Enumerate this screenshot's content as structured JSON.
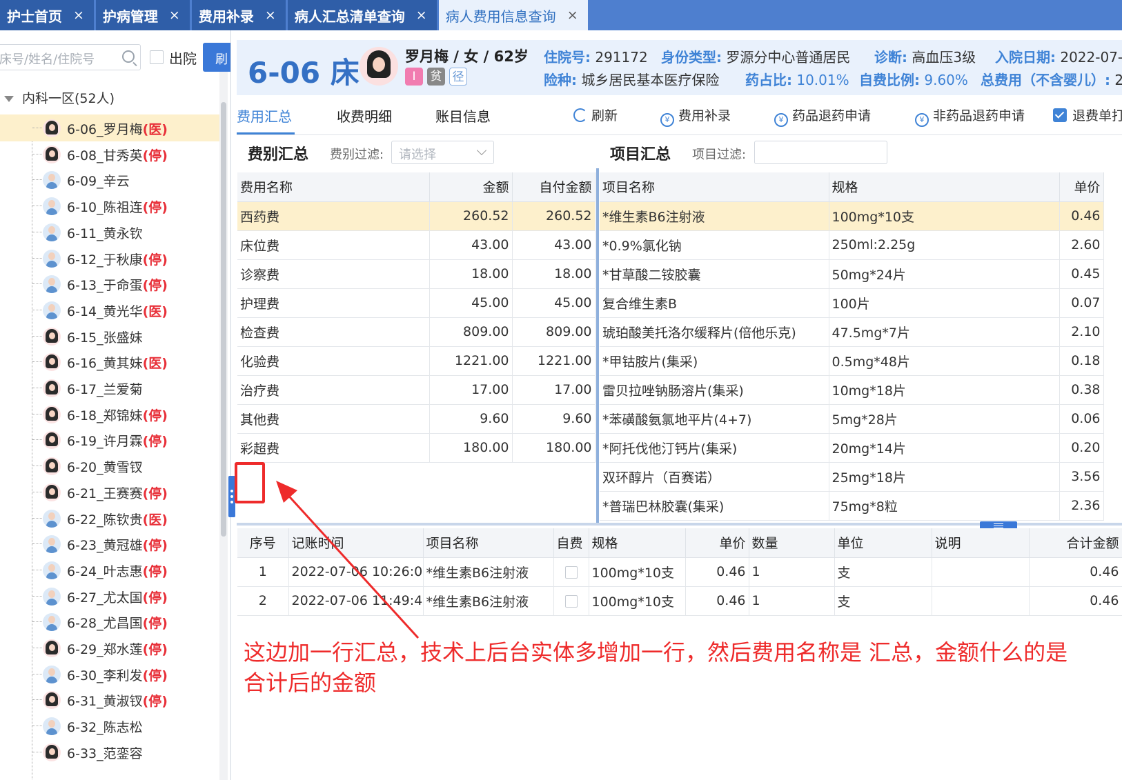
{
  "tabs": [
    {
      "label": "护士首页",
      "active": false
    },
    {
      "label": "护病管理",
      "active": false
    },
    {
      "label": "费用补录",
      "active": false
    },
    {
      "label": "病人汇总清单查询",
      "active": false
    },
    {
      "label": "病人费用信息查询",
      "active": true
    }
  ],
  "tab_close_glyph": "×",
  "sidebar": {
    "search_placeholder": "床号/姓名/住院号",
    "discharged_label": "出院",
    "refresh_label": "刷",
    "ward": "内科一区(52人)",
    "patients": [
      {
        "label": "6-06_罗月梅",
        "status": "(医)",
        "gender": "f",
        "selected": true
      },
      {
        "label": "6-08_甘秀英",
        "status": "(停)",
        "gender": "f"
      },
      {
        "label": "6-09_辛云",
        "status": "",
        "gender": "m"
      },
      {
        "label": "6-10_陈祖连",
        "status": "(停)",
        "gender": "m"
      },
      {
        "label": "6-11_黄永钦",
        "status": "",
        "gender": "m"
      },
      {
        "label": "6-12_于秋康",
        "status": "(停)",
        "gender": "m"
      },
      {
        "label": "6-13_于命蛋",
        "status": "(停)",
        "gender": "m"
      },
      {
        "label": "6-14_黄光华",
        "status": "(医)",
        "gender": "m"
      },
      {
        "label": "6-15_张盛妹",
        "status": "",
        "gender": "f"
      },
      {
        "label": "6-16_黄其妹",
        "status": "(医)",
        "gender": "f"
      },
      {
        "label": "6-17_兰爱菊",
        "status": "",
        "gender": "f"
      },
      {
        "label": "6-18_郑锦妹",
        "status": "(停)",
        "gender": "f"
      },
      {
        "label": "6-19_许月霖",
        "status": "(停)",
        "gender": "f"
      },
      {
        "label": "6-20_黄雪钗",
        "status": "",
        "gender": "f"
      },
      {
        "label": "6-21_王赛赛",
        "status": "(停)",
        "gender": "f"
      },
      {
        "label": "6-22_陈钦贵",
        "status": "(医)",
        "gender": "m"
      },
      {
        "label": "6-23_黄冠雄",
        "status": "(停)",
        "gender": "m"
      },
      {
        "label": "6-24_叶志惠",
        "status": "(停)",
        "gender": "m"
      },
      {
        "label": "6-27_尤太国",
        "status": "(停)",
        "gender": "m"
      },
      {
        "label": "6-28_尤昌国",
        "status": "(停)",
        "gender": "m"
      },
      {
        "label": "6-29_郑水莲",
        "status": "(停)",
        "gender": "f"
      },
      {
        "label": "6-30_李利发",
        "status": "(停)",
        "gender": "m"
      },
      {
        "label": "6-31_黄淑钗",
        "status": "(停)",
        "gender": "f"
      },
      {
        "label": "6-32_陈志松",
        "status": "",
        "gender": "m"
      },
      {
        "label": "6-33_范銮容",
        "status": "",
        "gender": "f"
      }
    ]
  },
  "patient": {
    "bed": "6-06 床",
    "name_line": "罗月梅 / 女 / 62岁",
    "badges": [
      "I",
      "贫",
      "径"
    ],
    "admission_no_label": "住院号:",
    "admission_no": "291172",
    "identity_label": "身份类型:",
    "identity": "罗源分中心普通居民",
    "diagnosis_label": "诊断:",
    "diagnosis": "高血压3级",
    "admit_date_label": "入院日期:",
    "admit_date": "2022-07-0",
    "insurance_label": "险种:",
    "insurance": "城乡居民基本医疗保险",
    "drug_ratio_label": "药占比:",
    "drug_ratio": "10.01%",
    "self_pay_ratio_label": "自费比例:",
    "self_pay_ratio": "9.60%",
    "total_label": "总费用（不含婴儿）:",
    "total": "2"
  },
  "subtabs": [
    "费用汇总",
    "收费明细",
    "账目信息"
  ],
  "actions": {
    "refresh": "刷新",
    "fee_supplement": "费用补录",
    "drug_refund": "药品退药申请",
    "nondrug_refund": "非药品退药申请",
    "refund_single": "退费单打"
  },
  "fee_summary": {
    "title": "费别汇总",
    "filter_label": "费别过滤:",
    "filter_placeholder": "请选择",
    "columns": [
      "费用名称",
      "金额",
      "自付金额"
    ],
    "rows": [
      [
        "西药费",
        "260.52",
        "260.52"
      ],
      [
        "床位费",
        "43.00",
        "43.00"
      ],
      [
        "诊察费",
        "18.00",
        "18.00"
      ],
      [
        "护理费",
        "45.00",
        "45.00"
      ],
      [
        "检查费",
        "809.00",
        "809.00"
      ],
      [
        "化验费",
        "1221.00",
        "1221.00"
      ],
      [
        "治疗费",
        "17.00",
        "17.00"
      ],
      [
        "其他费",
        "9.60",
        "9.60"
      ],
      [
        "彩超费",
        "180.00",
        "180.00"
      ]
    ]
  },
  "item_summary": {
    "title": "项目汇总",
    "filter_label": "项目过滤:",
    "columns": [
      "项目名称",
      "规格",
      "单价"
    ],
    "rows": [
      [
        "*维生素B6注射液",
        "100mg*10支",
        "0.46"
      ],
      [
        "*0.9%氯化钠",
        "250ml:2.25g",
        "2.60"
      ],
      [
        "*甘草酸二铵胶囊",
        "50mg*24片",
        "0.45"
      ],
      [
        "复合维生素B",
        "100片",
        "0.07"
      ],
      [
        "琥珀酸美托洛尔缓释片(倍他乐克)",
        "47.5mg*7片",
        "2.10"
      ],
      [
        "*甲钴胺片(集采)",
        "0.5mg*48片",
        "0.18"
      ],
      [
        "雷贝拉唑钠肠溶片(集采)",
        "10mg*18片",
        "0.38"
      ],
      [
        "*苯磺酸氨氯地平片(4+7)",
        "5mg*28片",
        "0.06"
      ],
      [
        "*阿托伐他汀钙片(集采)",
        "20mg*14片",
        "0.20"
      ],
      [
        "双环醇片（百赛诺）",
        "25mg*18片",
        "3.56"
      ],
      [
        "*普瑞巴林胶囊(集采)",
        "75mg*8粒",
        "2.36"
      ]
    ]
  },
  "detail": {
    "columns": [
      "序号",
      "记账时间",
      "项目名称",
      "自费",
      "规格",
      "单价",
      "数量",
      "单位",
      "说明",
      "合计金额"
    ],
    "rows": [
      [
        "1",
        "2022-07-06 10:26:02",
        "*维生素B6注射液",
        "",
        "100mg*10支",
        "0.46",
        "1",
        "支",
        "",
        "0.46"
      ],
      [
        "2",
        "2022-07-06 11:49:44",
        "*维生素B6注射液",
        "",
        "100mg*10支",
        "0.46",
        "1",
        "支",
        "",
        "0.46"
      ]
    ]
  },
  "annotation": {
    "text": "这边加一行汇总，技术上后台实体多增加一行，然后费用名称是 汇总，金额什么的是合计后的金额",
    "color": "#ee2b2b"
  },
  "colors": {
    "accent": "#3f83d6",
    "tab_dark": "#2f5ea8",
    "selected_row": "#fdf0cc",
    "status_red": "#e8313a"
  }
}
